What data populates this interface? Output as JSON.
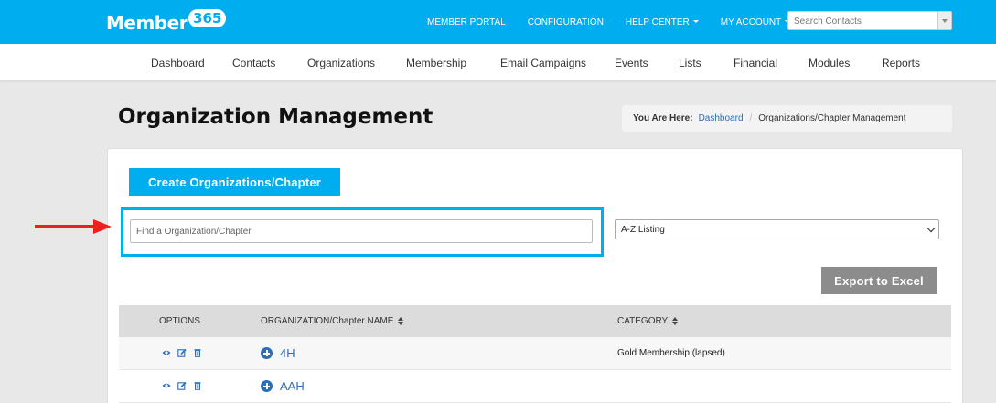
{
  "brand": {
    "name": "Member",
    "badge": "365"
  },
  "topnav": {
    "member_portal": "MEMBER PORTAL",
    "configuration": "CONFIGURATION",
    "help_center": "HELP CENTER",
    "my_account": "MY ACCOUNT",
    "search_placeholder": "Search Contacts"
  },
  "subnav": [
    "Dashboard",
    "Contacts",
    "Organizations",
    "Membership",
    "Email Campaigns",
    "Events",
    "Lists",
    "Financial",
    "Modules",
    "Reports"
  ],
  "page": {
    "title": "Organization Management"
  },
  "breadcrumb": {
    "label": "You Are Here:",
    "home": "Dashboard",
    "separator": "/",
    "current": "Organizations/Chapter Management"
  },
  "actions": {
    "create_label": "Create Organizations/Chapter",
    "find_placeholder": "Find a Organization/Chapter",
    "listing_selected": "A-Z Listing",
    "export_label": "Export to Excel"
  },
  "table": {
    "columns": {
      "options": "OPTIONS",
      "name": "ORGANIZATION/Chapter NAME",
      "category": "CATEGORY"
    },
    "rows": [
      {
        "name": "4H",
        "category": "Gold Membership (lapsed)"
      },
      {
        "name": "AAH",
        "category": ""
      }
    ]
  },
  "colors": {
    "brand": "#00aeef",
    "link": "#2a6ebb",
    "export_button": "#8c8c8c",
    "annotation_arrow": "#e8231c",
    "highlight_box": "#00aeef"
  },
  "icons": {
    "options": [
      "eye-icon",
      "edit-icon",
      "trash-icon"
    ],
    "expand": "plus-circle-icon",
    "annotation": "arrow-right-icon"
  }
}
